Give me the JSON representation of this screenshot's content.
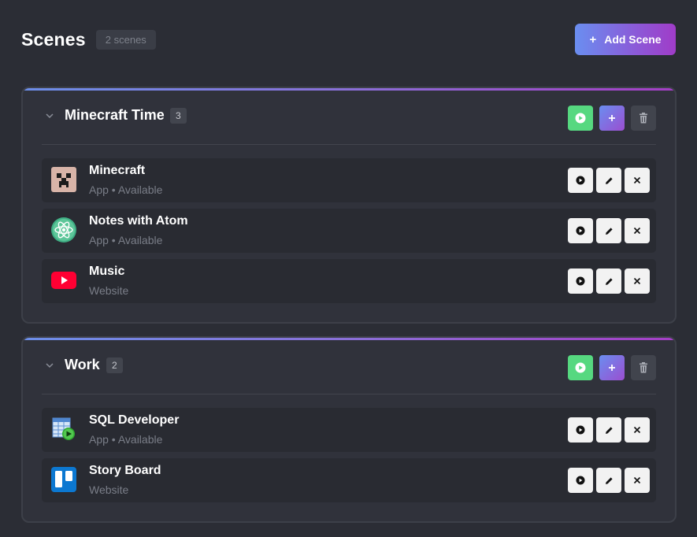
{
  "header": {
    "title": "Scenes",
    "count": "2 scenes",
    "add_label": "Add Scene",
    "add_icon": "+"
  },
  "colors": {
    "background": "#2b2d35",
    "card": "#30323b",
    "item": "#292b32",
    "play_green": "#56d880",
    "gradient_start": "#6a8ef0",
    "gradient_end": "#a03cc8"
  },
  "scenes": [
    {
      "name": "Minecraft Time",
      "count": "3",
      "items": [
        {
          "name": "Minecraft",
          "meta": "App • Available",
          "icon": "minecraft-icon"
        },
        {
          "name": "Notes with Atom",
          "meta": "App • Available",
          "icon": "atom-icon"
        },
        {
          "name": "Music",
          "meta": "Website",
          "icon": "youtube-icon"
        }
      ]
    },
    {
      "name": "Work",
      "count": "2",
      "items": [
        {
          "name": "SQL Developer",
          "meta": "App • Available",
          "icon": "sql-developer-icon"
        },
        {
          "name": "Story Board",
          "meta": "Website",
          "icon": "trello-icon"
        }
      ]
    }
  ]
}
